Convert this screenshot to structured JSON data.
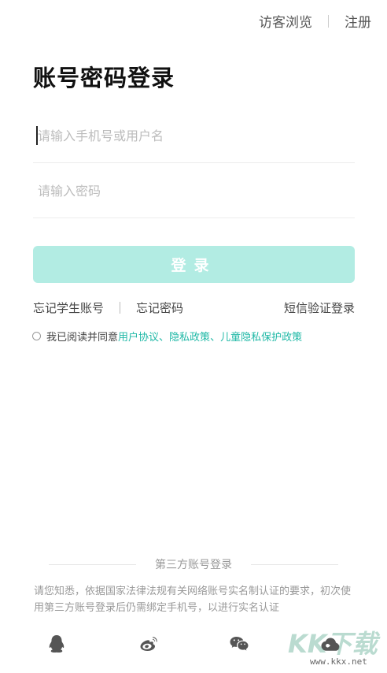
{
  "topbar": {
    "guest_label": "访客浏览",
    "register_label": "注册"
  },
  "page_title": "账号密码登录",
  "form": {
    "username_placeholder": "请输入手机号或用户名",
    "password_placeholder": "请输入密码",
    "login_label": "登录"
  },
  "links": {
    "forgot_student_account": "忘记学生账号",
    "forgot_password": "忘记密码",
    "sms_login": "短信验证登录"
  },
  "agreement": {
    "prefix": "我已阅读并同意",
    "user_agreement": "用户协议",
    "sep1": "、",
    "privacy_policy": "隐私政策",
    "sep2": "、",
    "child_privacy_policy": "儿童隐私保护政策"
  },
  "third_party": {
    "title": "第三方账号登录",
    "notice": "请您知悉，依据国家法律法规有关网络账号实名制认证的要求，初次使用第三方账号登录后仍需绑定手机号，以进行实名认证",
    "icons": [
      "qq-icon",
      "weibo-icon",
      "wechat-icon",
      "cloud-icon"
    ]
  },
  "watermark": {
    "logo_text": "KK下载",
    "url": "www.kkx.net"
  },
  "colors": {
    "accent": "#1fb8a6",
    "login_button_disabled": "#b2ece3"
  }
}
